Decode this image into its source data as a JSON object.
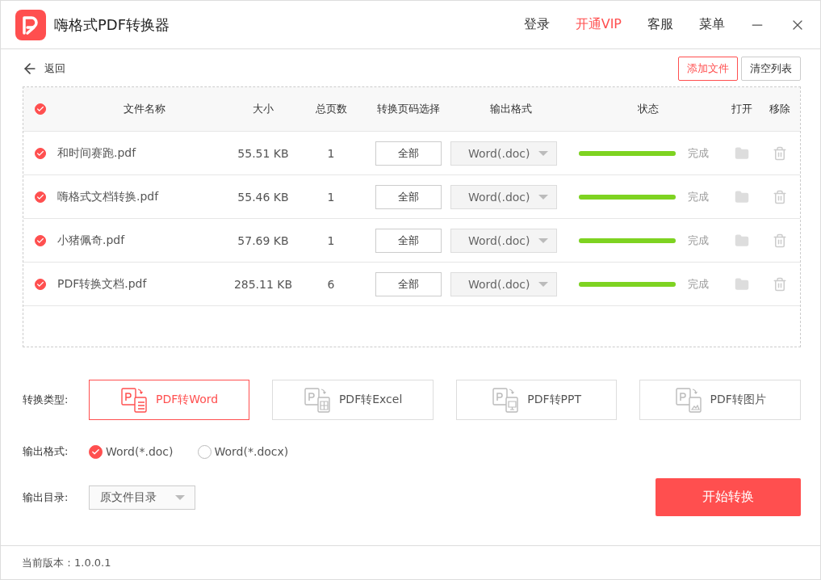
{
  "window": {
    "title": "嗨格式PDF转换器",
    "nav": [
      {
        "label": "登录",
        "highlight": false
      },
      {
        "label": "开通VIP",
        "highlight": true
      },
      {
        "label": "客服",
        "highlight": false
      },
      {
        "label": "菜单",
        "highlight": false
      }
    ]
  },
  "toolbar": {
    "back": "返回",
    "add_files": "添加文件",
    "clear_list": "清空列表"
  },
  "table": {
    "all_checked": true,
    "columns": [
      "文件名称",
      "大小",
      "总页数",
      "转换页码选择",
      "输出格式",
      "状态",
      "打开",
      "移除"
    ],
    "rows": [
      {
        "checked": true,
        "name": "和时间赛跑.pdf",
        "size": "55.51 KB",
        "pages": "1",
        "range": "全部",
        "format": "Word(.doc)",
        "level": 1,
        "status": "完成"
      },
      {
        "checked": true,
        "name": "嗨格式文档转换.pdf",
        "size": "55.46 KB",
        "pages": "1",
        "range": "全部",
        "format": "Word(.doc)",
        "level": 1,
        "status": "完成"
      },
      {
        "checked": true,
        "name": "小猪佩奇.pdf",
        "size": "57.69 KB",
        "pages": "1",
        "range": "全部",
        "format": "Word(.doc)",
        "level": 1,
        "status": "完成"
      },
      {
        "checked": true,
        "name": "PDF转换文档.pdf",
        "size": "285.11 KB",
        "pages": "6",
        "range": "全部",
        "format": "Word(.doc)",
        "level": 1,
        "status": "完成"
      }
    ]
  },
  "conversion_type": {
    "label": "转换类型:",
    "options": [
      {
        "label": "PDF转Word",
        "kind": "word",
        "selected": true
      },
      {
        "label": "PDF转Excel",
        "kind": "excel",
        "selected": false
      },
      {
        "label": "PDF转PPT",
        "kind": "ppt",
        "selected": false
      },
      {
        "label": "PDF转图片",
        "kind": "image",
        "selected": false
      }
    ]
  },
  "output_format": {
    "label": "输出格式:",
    "options": [
      {
        "label": "Word(*.doc)",
        "selected": true
      },
      {
        "label": "Word(*.docx)",
        "selected": false
      }
    ]
  },
  "output_dir": {
    "label": "输出目录:",
    "value": "原文件目录"
  },
  "start_button": "开始转换",
  "status_bar": "当前版本：1.0.0.1"
}
